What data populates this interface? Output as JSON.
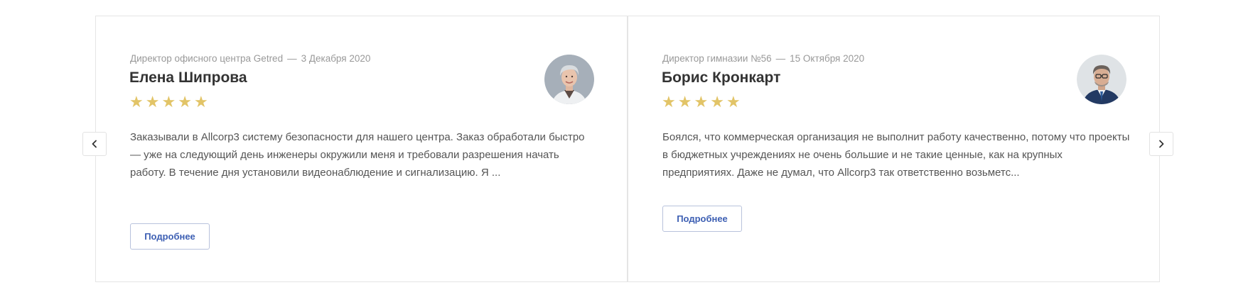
{
  "reviews": [
    {
      "position": "Директор офисного центра Getred",
      "separator": "—",
      "date": "3 Декабря 2020",
      "name": "Елена Шипрова",
      "rating": 5,
      "stars": [
        "★",
        "★",
        "★",
        "★",
        "★"
      ],
      "text": "Заказывали в Allcorp3 систему безопасности для нашего центра. Заказ обработали быстро — уже на следующий день инженеры окружили меня и требовали разрешения начать работу. В течение дня установили видеонаблюдение и сигнализацию. Я ...",
      "button_label": "Подробнее",
      "avatar_icon": "woman-portrait-icon"
    },
    {
      "position": "Директор гимназии №56",
      "separator": "—",
      "date": "15 Октября 2020",
      "name": "Борис Кронкарт",
      "rating": 5,
      "stars": [
        "★",
        "★",
        "★",
        "★",
        "★"
      ],
      "text": "Боялся, что коммерческая организация не выполнит работу качественно, потому что проекты в бюджетных учреждениях не очень большие и не такие ценные, как на крупных предприятиях. Даже не думал, что Allcorp3 так ответственно возьметс...",
      "button_label": "Подробнее",
      "avatar_icon": "man-portrait-icon"
    }
  ],
  "nav": {
    "prev_icon": "chevron-left-icon",
    "next_icon": "chevron-right-icon"
  },
  "colors": {
    "star": "#e2c467",
    "button_text": "#3d5fb3",
    "meta_text": "#999999"
  }
}
